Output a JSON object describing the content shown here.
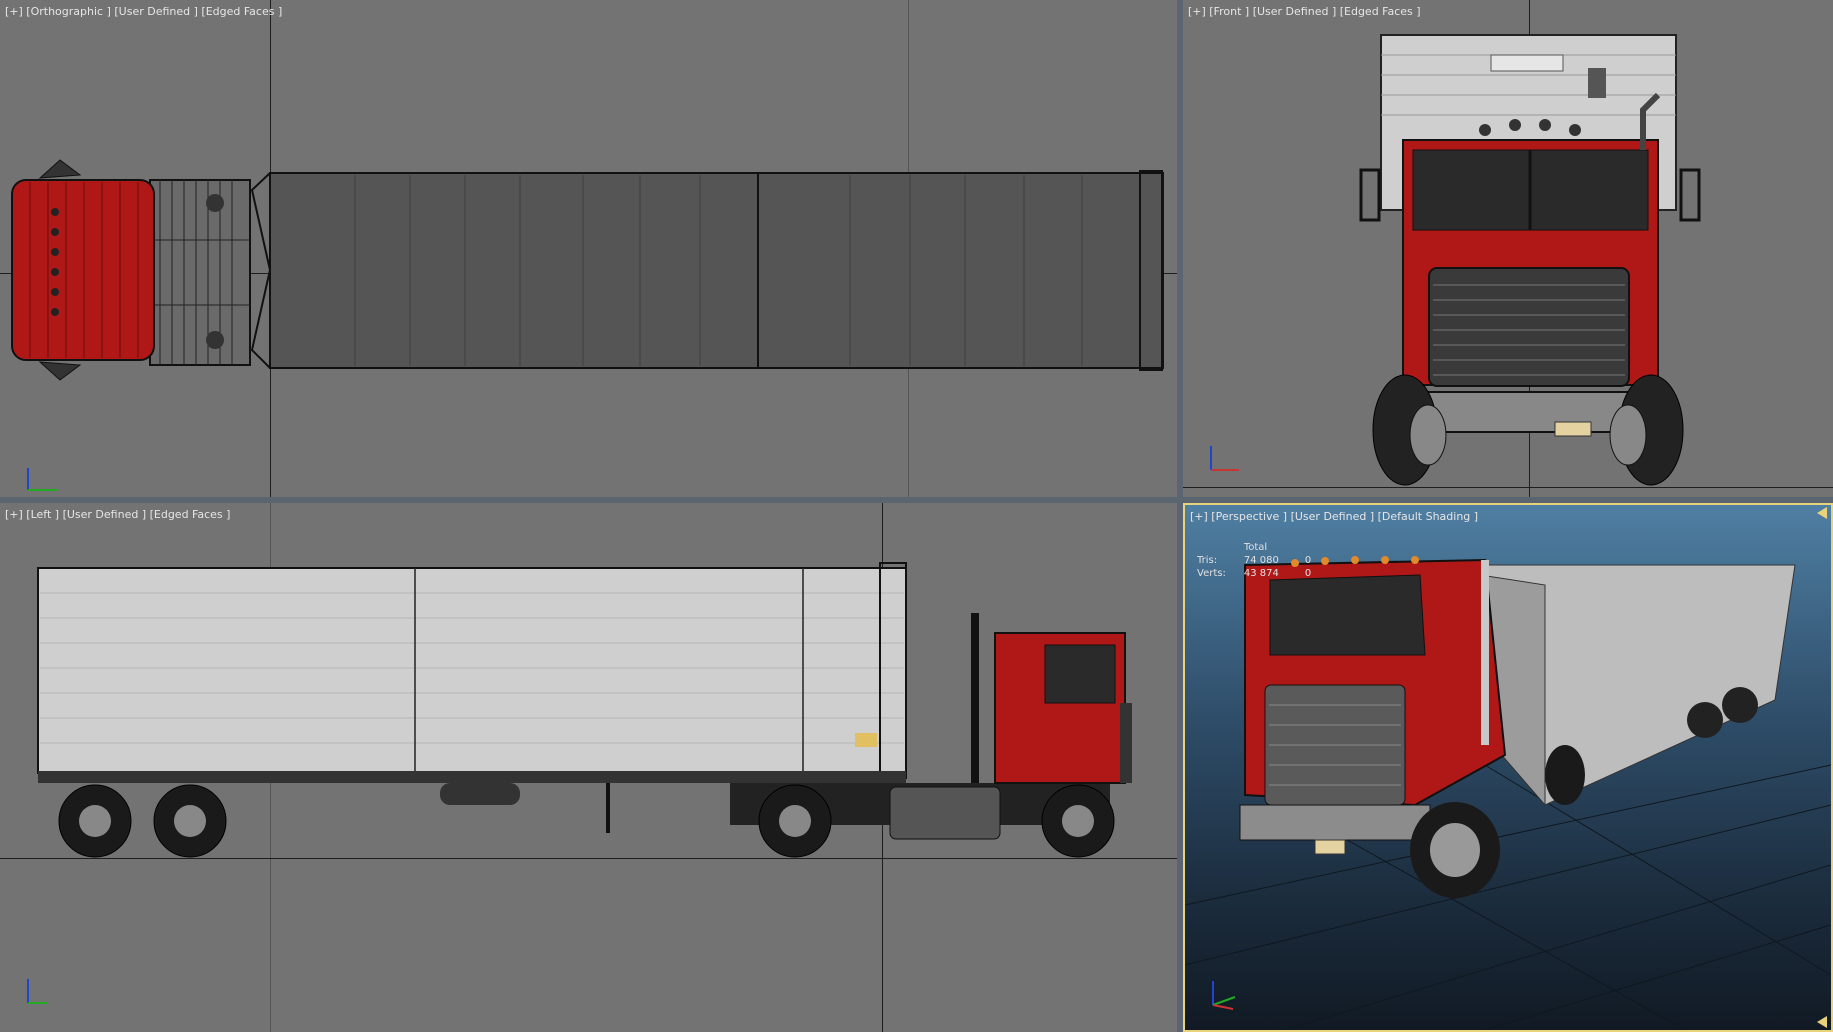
{
  "viewports": {
    "top": {
      "label": "[+] [Orthographic ] [User Defined ] [Edged Faces ]"
    },
    "front": {
      "label": "[+] [Front ] [User Defined ] [Edged Faces ]"
    },
    "left": {
      "label": "[+] [Left ] [User Defined ] [Edged Faces ]"
    },
    "perspective": {
      "label": "[+] [Perspective ] [User Defined ] [Default Shading ]"
    }
  },
  "stats": {
    "header": "Total",
    "rows": [
      {
        "label": "Tris:",
        "total": "74 080",
        "selected": "0"
      },
      {
        "label": "Verts:",
        "total": "43 874",
        "selected": "0"
      }
    ]
  },
  "gizmo": {
    "x": "x",
    "y": "y",
    "z": "z"
  },
  "colors": {
    "cab_red": "#b01818",
    "trailer_dark": "#5a5a5a",
    "trailer_light": "#cfcfcf",
    "viewport_bg": "#737373",
    "active_border": "#e8d27a"
  }
}
